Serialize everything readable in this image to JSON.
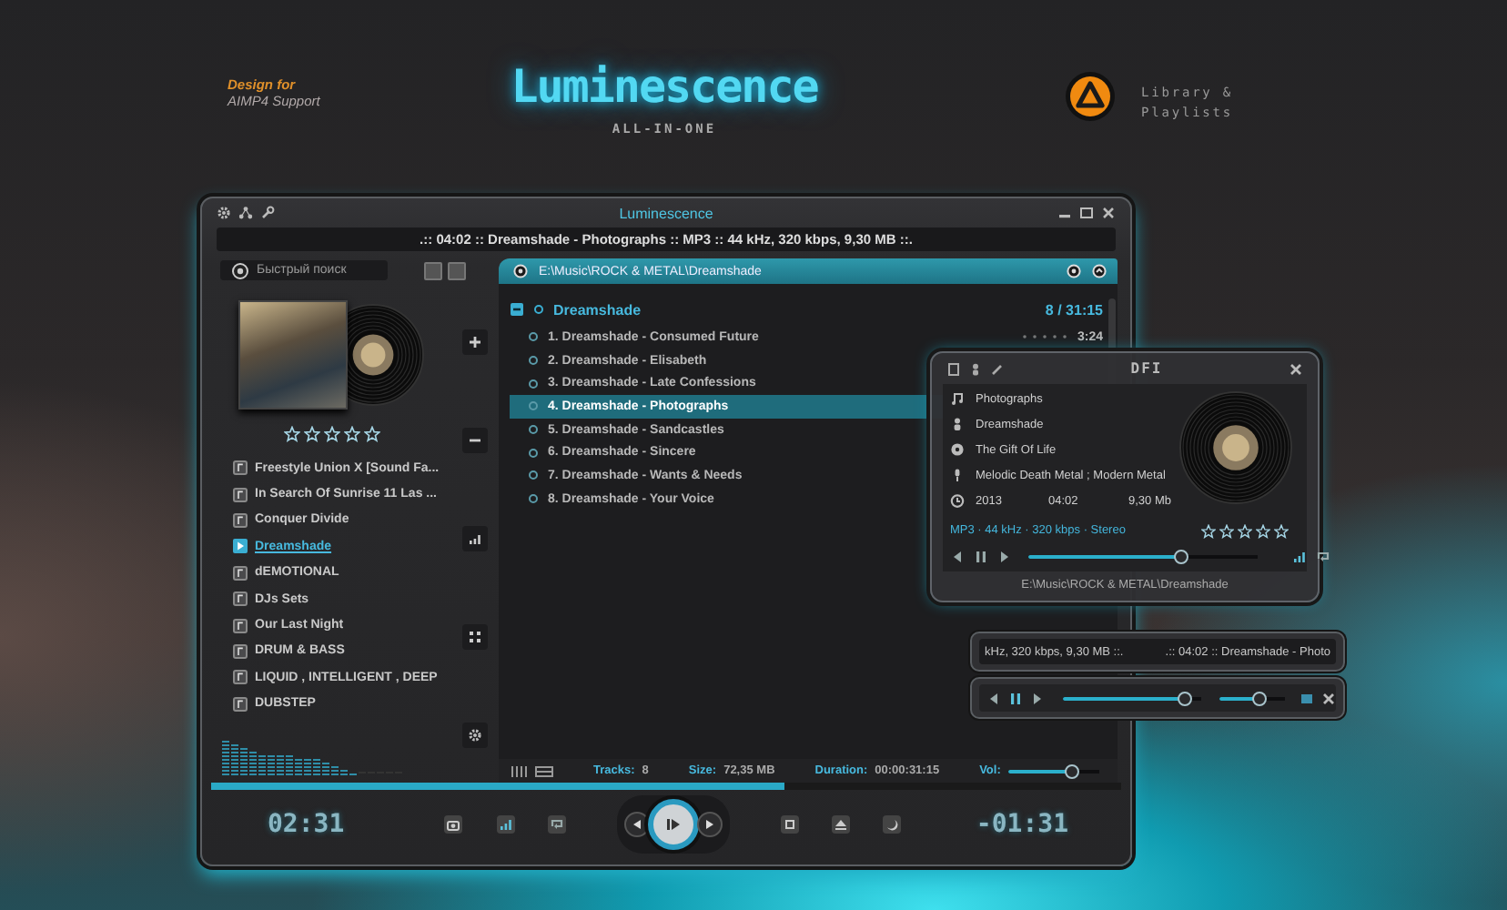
{
  "promo": {
    "design_for": "Design for",
    "support": "AIMP4 Support",
    "title": "Luminescence",
    "subtitle": "ALL-IN-ONE",
    "feature": "Library & Playlists"
  },
  "main_window": {
    "title": "Luminescence",
    "now_playing": ".:: 04:02 :: Dreamshade - Photographs :: MP3 :: 44 kHz, 320 kbps, 9,30 MB ::.",
    "search": {
      "placeholder": "Быстрый поиск"
    },
    "album": {
      "stars": 0
    },
    "playlists": [
      {
        "name": "Freestyle Union X [Sound Fa...",
        "selected": false
      },
      {
        "name": "In Search Of Sunrise 11 Las ...",
        "selected": false
      },
      {
        "name": "Conquer Divide",
        "selected": false
      },
      {
        "name": "Dreamshade",
        "selected": true
      },
      {
        "name": "dEMOTIONAL",
        "selected": false
      },
      {
        "name": "DJs Sets",
        "selected": false
      },
      {
        "name": "Our Last Night",
        "selected": false
      },
      {
        "name": "DRUM & BASS",
        "selected": false
      },
      {
        "name": "LIQUID , INTELLIGENT , DEEP",
        "selected": false
      },
      {
        "name": "DUBSTEP",
        "selected": false
      }
    ],
    "path": "E:\\Music\\ROCK & METAL\\Dreamshade",
    "group": {
      "name": "Dreamshade",
      "expanded": true,
      "summary": "8 / 31:15"
    },
    "tracks": [
      {
        "title": "1. Dreamshade - Consumed Future",
        "selected": false,
        "duration": "3:24"
      },
      {
        "title": "2. Dreamshade - Elisabeth",
        "selected": false
      },
      {
        "title": "3. Dreamshade - Late Confessions",
        "selected": false
      },
      {
        "title": "4. Dreamshade - Photographs",
        "selected": true
      },
      {
        "title": "5. Dreamshade - Sandcastles",
        "selected": false
      },
      {
        "title": "6. Dreamshade - Sincere",
        "selected": false
      },
      {
        "title": "7. Dreamshade - Wants & Needs",
        "selected": false
      },
      {
        "title": "8. Dreamshade - Your Voice",
        "selected": false
      }
    ],
    "status": {
      "tracks_label": "Tracks:",
      "tracks": "8",
      "size_label": "Size:",
      "size": "72,35 MB",
      "duration_label": "Duration:",
      "duration": "00:00:31:15",
      "volume_label": "Vol:",
      "volume": {
        "level": 0.7
      }
    },
    "progress": {
      "level": 0.63
    },
    "elapsed": "02:31",
    "remaining": "-01:31"
  },
  "dfi": {
    "title": "DFI",
    "fields": [
      {
        "kind": "title",
        "value": "Photographs"
      },
      {
        "kind": "artist",
        "value": "Dreamshade"
      },
      {
        "kind": "album",
        "value": "The Gift Of Life"
      },
      {
        "kind": "genre",
        "value": "Melodic Death Metal ; Modern Metal"
      }
    ],
    "year": "2013",
    "length": "04:02",
    "size": "9,30 Mb",
    "format": "MP3 · 44 kHz · 320 kbps · Stereo",
    "stars": 0,
    "seek": {
      "level": 0.67
    },
    "path": "E:\\Music\\ROCK & METAL\\Dreamshade"
  },
  "mini_player": {
    "info_left": "kHz, 320 kbps, 9,30 MB ::.",
    "info_right": ".:: 04:02 :: Dreamshade - Photo",
    "seek": {
      "level": 0.88
    },
    "volume": {
      "level": 0.6
    }
  }
}
